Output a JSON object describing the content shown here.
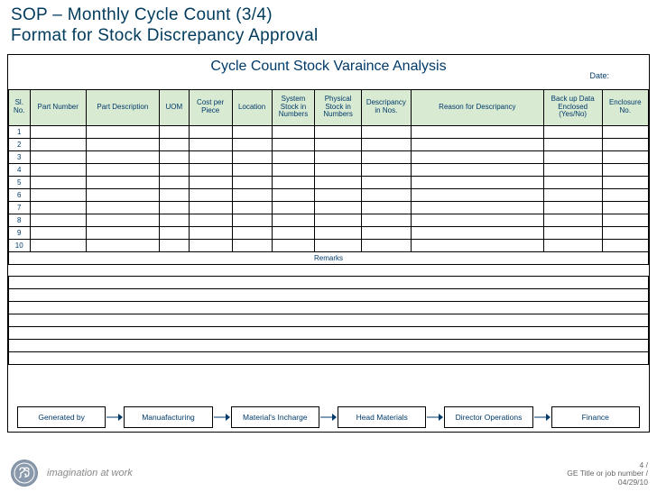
{
  "title": {
    "line1": "SOP – Monthly Cycle Count (3/4)",
    "line2": "Format for Stock Discrepancy Approval"
  },
  "form": {
    "heading": "Cycle Count Stock Varaince Analysis",
    "date_label": "Date:",
    "columns": {
      "sl": "Sl. No.",
      "part": "Part Number",
      "desc": "Part Description",
      "uom": "UOM",
      "cost": "Cost per Piece",
      "loc": "Location",
      "sys": "System Stock in Numbers",
      "phys": "Physical Stock in Numbers",
      "disc": "Descripancy in Nos.",
      "reason": "Reason for Descripancy",
      "back": "Back up Data Enclosed (Yes/No)",
      "enc": "Enclosure No."
    },
    "rows": [
      "1",
      "2",
      "3",
      "4",
      "5",
      "6",
      "7",
      "8",
      "9",
      "10"
    ],
    "remarks_label": "Remarks"
  },
  "flow": {
    "steps": [
      "Generated by",
      "Manuafacturing",
      "Material's Incharge",
      "Head Materials",
      "Director Operations",
      "Finance"
    ]
  },
  "footer": {
    "tagline": "imagination at work",
    "page": "4 /",
    "meta": "GE Title or job number /",
    "date": "04/29/10"
  }
}
